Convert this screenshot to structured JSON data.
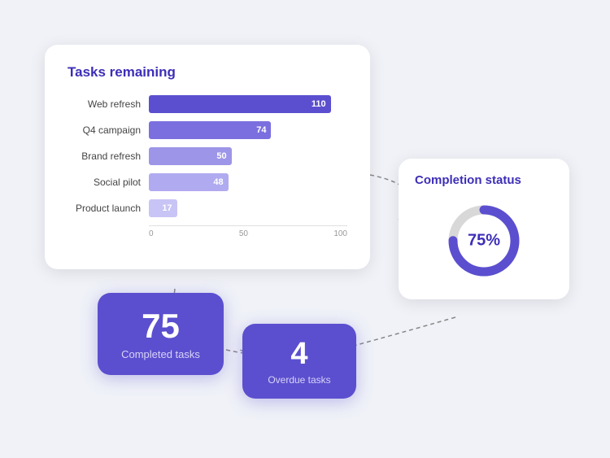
{
  "tasks_remaining_card": {
    "title": "Tasks remaining",
    "bars": [
      {
        "label": "Web refresh",
        "value": 110,
        "max": 120,
        "color": "#5b4fcf"
      },
      {
        "label": "Q4 campaign",
        "value": 74,
        "max": 120,
        "color": "#7b6fdf"
      },
      {
        "label": "Brand refresh",
        "value": 50,
        "max": 120,
        "color": "#9d95e8"
      },
      {
        "label": "Social pilot",
        "value": 48,
        "max": 120,
        "color": "#b0aaf0"
      },
      {
        "label": "Product launch",
        "value": 17,
        "max": 120,
        "color": "#c8c4f5"
      }
    ],
    "axis_ticks": [
      "0",
      "50",
      "100"
    ]
  },
  "completion_card": {
    "title": "Completion status",
    "percentage": "75%",
    "value": 75,
    "color_filled": "#5b4fcf",
    "color_empty": "#d8d8d8"
  },
  "completed_card": {
    "number": "75",
    "label": "Completed tasks"
  },
  "overdue_card": {
    "number": "4",
    "label": "Overdue tasks"
  }
}
